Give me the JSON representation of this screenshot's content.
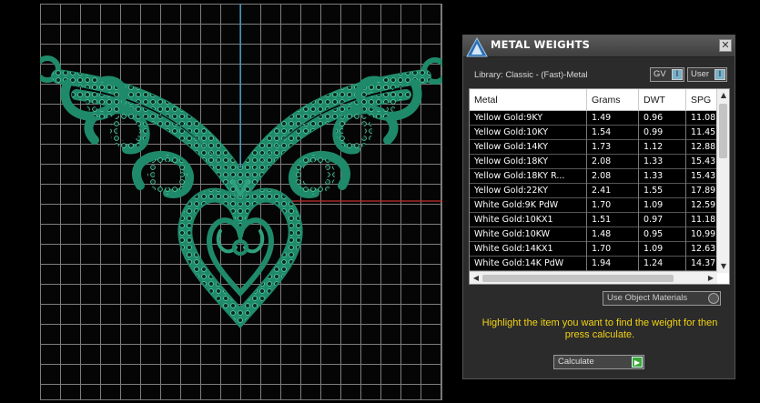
{
  "panel": {
    "title": "METAL WEIGHTS",
    "close_glyph": "✕",
    "library_label": "Library: Classic - (Fast)-Metal",
    "gv_label": "GV",
    "user_label": "User",
    "toggle_glyph": "I"
  },
  "table": {
    "headers": [
      "Metal",
      "Grams",
      "DWT",
      "SPG"
    ],
    "rows": [
      [
        "Yellow Gold:9KY",
        "1.49",
        "0.96",
        "11.08"
      ],
      [
        "Yellow Gold:10KY",
        "1.54",
        "0.99",
        "11.45"
      ],
      [
        "Yellow Gold:14KY",
        "1.73",
        "1.12",
        "12.88"
      ],
      [
        "Yellow Gold:18KY",
        "2.08",
        "1.33",
        "15.43"
      ],
      [
        "Yellow Gold:18KY R...",
        "2.08",
        "1.33",
        "15.43"
      ],
      [
        "Yellow Gold:22KY",
        "2.41",
        "1.55",
        "17.89"
      ],
      [
        "White Gold:9K PdW",
        "1.70",
        "1.09",
        "12.59"
      ],
      [
        "White Gold:10KX1",
        "1.51",
        "0.97",
        "11.18"
      ],
      [
        "White Gold:10KW",
        "1.48",
        "0.95",
        "10.99"
      ],
      [
        "White Gold:14KX1",
        "1.70",
        "1.09",
        "12.63"
      ],
      [
        "White Gold:14K PdW",
        "1.94",
        "1.24",
        "14.37"
      ]
    ]
  },
  "use_object_materials_label": "Use Object Materials",
  "instructions": "Highlight the item you want to find the weight for then press calculate.",
  "calculate_label": "Calculate",
  "calculate_glyph": "▶",
  "colors": {
    "jewelry_green": "#1f8a6a",
    "highlight_yellow": "#f2d315",
    "axis_blue": "#3aa0d0",
    "axis_red": "#c83030"
  },
  "icons": [
    "app-logo-icon",
    "close-icon",
    "toggle-gv-icon",
    "toggle-user-icon",
    "dropdown-icon",
    "play-icon"
  ]
}
